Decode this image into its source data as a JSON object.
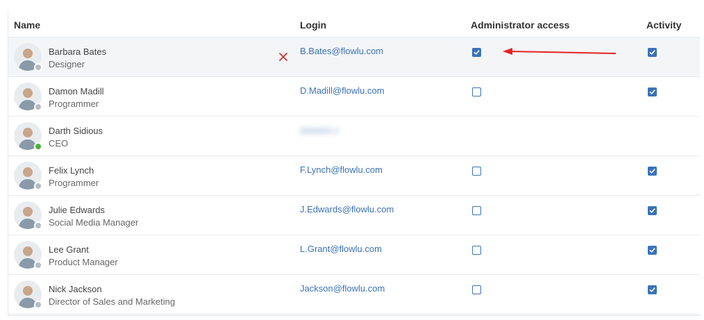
{
  "columns": {
    "name": "Name",
    "login": "Login",
    "admin": "Administrator access",
    "activity": "Activity"
  },
  "colors": {
    "link": "#3a71b8",
    "checkbox": "#3b72b9",
    "remove": "#d93030",
    "arrow": "#e52222",
    "online": "#46b43a",
    "offline": "#b7bcc2"
  },
  "users": [
    {
      "name": "Barbara Bates",
      "role": "Designer",
      "login": "B.Bates@flowlu.com",
      "admin": true,
      "activity": true,
      "online": false,
      "highlight": true
    },
    {
      "name": "Damon Madill",
      "role": "Programmer",
      "login": "D.Madill@flowlu.com",
      "admin": false,
      "activity": true,
      "online": false
    },
    {
      "name": "Darth Sidious",
      "role": "CEO",
      "login": "",
      "admin": null,
      "activity": null,
      "online": true,
      "login_blurred": true
    },
    {
      "name": "Felix Lynch",
      "role": "Programmer",
      "login": "F.Lynch@flowlu.com",
      "admin": false,
      "activity": true,
      "online": false
    },
    {
      "name": "Julie Edwards",
      "role": "Social Media Manager",
      "login": "J.Edwards@flowlu.com",
      "admin": false,
      "activity": true,
      "online": false
    },
    {
      "name": "Lee Grant",
      "role": "Product Manager",
      "login": "L.Grant@flowlu.com",
      "admin": false,
      "activity": true,
      "online": false
    },
    {
      "name": "Nick Jackson",
      "role": "Director of Sales and Marketing",
      "login": "Jackson@flowlu.com",
      "admin": false,
      "activity": true,
      "online": false
    }
  ]
}
